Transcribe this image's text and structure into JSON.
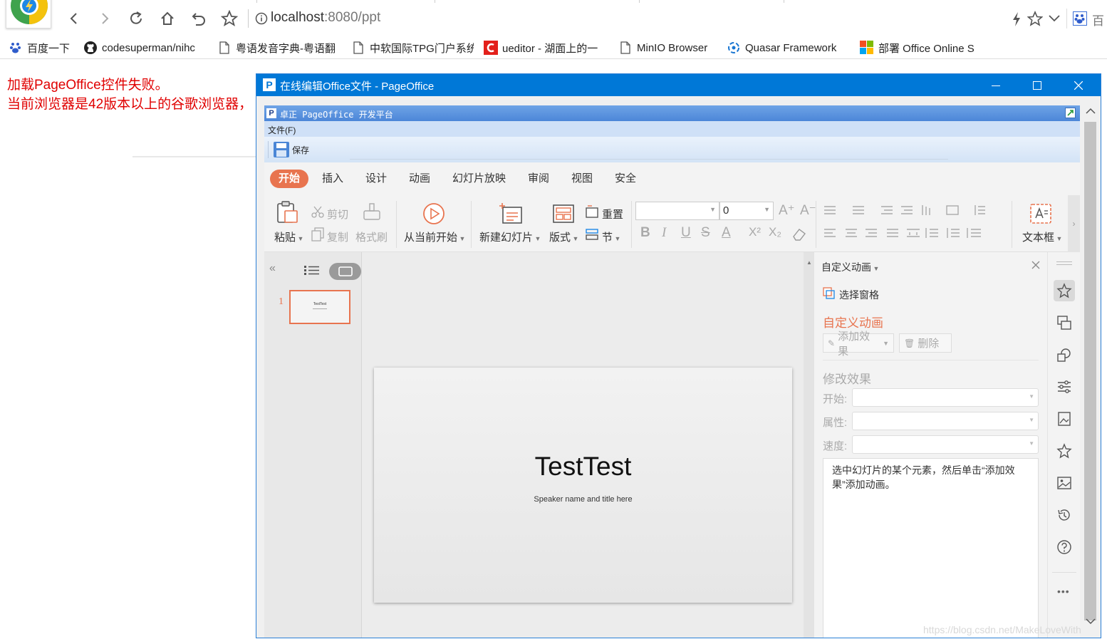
{
  "browser": {
    "url_host": "localhost",
    "url_path": ":8080/ppt",
    "right_partial": "百"
  },
  "bookmarks": [
    {
      "label": "百度一下",
      "icon": "baidu-icon"
    },
    {
      "label": "codesuperman/nihc",
      "icon": "github-icon"
    },
    {
      "label": "粤语发音字典-粤语翻",
      "icon": "page-icon"
    },
    {
      "label": "中软国际TPG门户系统",
      "icon": "page-icon"
    },
    {
      "label": "ueditor - 湖面上的一",
      "icon": "csdn-icon"
    },
    {
      "label": "MinIO Browser",
      "icon": "page-icon"
    },
    {
      "label": "Quasar Framework",
      "icon": "quasar-icon"
    },
    {
      "label": "部署 Office Online S",
      "icon": "office-icon"
    }
  ],
  "error": {
    "line1": "加载PageOffice控件失败。",
    "line2": "当前浏览器是42版本以上的谷歌浏览器，"
  },
  "window": {
    "title": "在线编辑Office文件 - PageOffice"
  },
  "pageoffice": {
    "bar_title": "卓正 PageOffice 开发平台",
    "menu_file": "文件(F)",
    "save": "保存"
  },
  "ribbon": {
    "tabs": [
      "开始",
      "插入",
      "设计",
      "动画",
      "幻灯片放映",
      "审阅",
      "视图",
      "安全"
    ],
    "active_tab": "开始",
    "paste": "粘贴",
    "cut": "剪切",
    "copy": "复制",
    "format_painter": "格式刷",
    "from_current": "从当前开始",
    "new_slide": "新建幻灯片",
    "layout": "版式",
    "reset": "重置",
    "section": "节",
    "font_size": "0",
    "textbox": "文本框"
  },
  "slides": {
    "number": "1",
    "thumb_title": "TestTest"
  },
  "slide": {
    "title": "TestTest",
    "subtitle": "Speaker name and title here"
  },
  "taskpane": {
    "header": "自定义动画",
    "select_pane": "选择窗格",
    "section_title": "自定义动画",
    "add_effect": "添加效果",
    "delete": "删除",
    "modify_title": "修改效果",
    "start_label": "开始:",
    "property_label": "属性:",
    "speed_label": "速度:",
    "hint": "选中幻灯片的某个元素，然后单击“添加效果”添加动画。"
  },
  "watermark": "https://blog.csdn.net/MakeLoveWith",
  "colors": {
    "titlebar": "#0078d7",
    "accent": "#e8744f",
    "error": "#e00000"
  }
}
